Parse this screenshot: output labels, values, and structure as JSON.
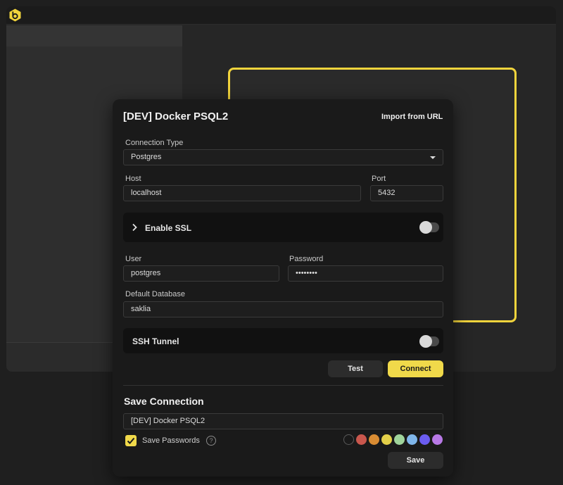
{
  "modal": {
    "title": "[DEV] Docker PSQL2",
    "import_link": "Import from URL"
  },
  "form": {
    "connection_type": {
      "label": "Connection Type",
      "value": "Postgres"
    },
    "host": {
      "label": "Host",
      "value": "localhost"
    },
    "port": {
      "label": "Port",
      "value": "5432"
    },
    "ssl": {
      "label": "Enable SSL",
      "enabled": false
    },
    "user": {
      "label": "User",
      "value": "postgres"
    },
    "password": {
      "label": "Password",
      "value": "••••••••"
    },
    "default_database": {
      "label": "Default Database",
      "value": "saklia"
    },
    "ssh": {
      "label": "SSH Tunnel",
      "enabled": false
    }
  },
  "actions": {
    "test_label": "Test",
    "connect_label": "Connect"
  },
  "save_connection": {
    "title": "Save Connection",
    "name_value": "[DEV] Docker PSQL2",
    "save_passwords_label": "Save Passwords",
    "save_passwords_checked": true,
    "help_symbol": "?",
    "save_label": "Save",
    "colors": [
      "#1a1a1a",
      "#c9574d",
      "#d98c33",
      "#e3cf49",
      "#9fd49b",
      "#7fb6ea",
      "#6a5cf0",
      "#b879e6"
    ]
  },
  "icons": {
    "logo": "app-logo-icon",
    "chevron": "chevron-right-icon",
    "caret": "caret-down-icon",
    "check": "check-icon",
    "help": "help-circle-icon"
  },
  "theme": {
    "accent": "#f0d94a",
    "frame": "#f2d43c"
  }
}
